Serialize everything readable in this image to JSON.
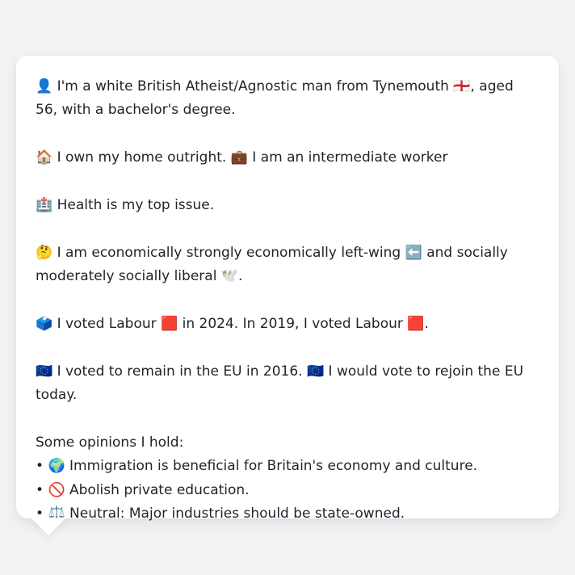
{
  "bio": {
    "identity_icon": "👤",
    "identity_text": "I'm a white British Atheist/Agnostic man from Tynemouth",
    "flag_icon": "🏴󠁧󠁢󠁥󠁮󠁧󠁿",
    "identity_text_2": ", aged 56, with a bachelor's degree.",
    "home_icon": "🏠",
    "home_text": "I own my home outright.",
    "work_icon": "💼",
    "work_text": "I am an intermediate worker",
    "health_icon": "🏥",
    "health_text": "Health is my top issue.",
    "thinking_icon": "🤔",
    "econ_text": "I am economically strongly economically left-wing",
    "left_arrow_icon": "⬅️",
    "social_text": "and socially moderately socially liberal",
    "dove_icon": "🕊️",
    "social_end": ".",
    "ballot_icon": "🗳️",
    "vote_text_1": "I voted Labour",
    "labour_icon": "🟥",
    "vote_text_2": "in 2024. In 2019, I voted Labour",
    "labour_icon_2": "🟥",
    "vote_end": ".",
    "eu_icon": "🇪🇺",
    "eu_text_1": "I voted to remain in the EU in 2016.",
    "eu_icon_2": "🇪🇺",
    "eu_text_2": "I would vote to rejoin the EU today."
  },
  "opinions": {
    "heading": "Some opinions I hold:",
    "items": [
      {
        "bullet": "•",
        "icon": "🌍",
        "text": "Immigration is beneficial for Britain's economy and culture."
      },
      {
        "bullet": "•",
        "icon": "🚫",
        "text": "Abolish private education."
      },
      {
        "bullet": "•",
        "icon": "⚖️",
        "text": "Neutral: Major industries should be state-owned."
      }
    ]
  }
}
